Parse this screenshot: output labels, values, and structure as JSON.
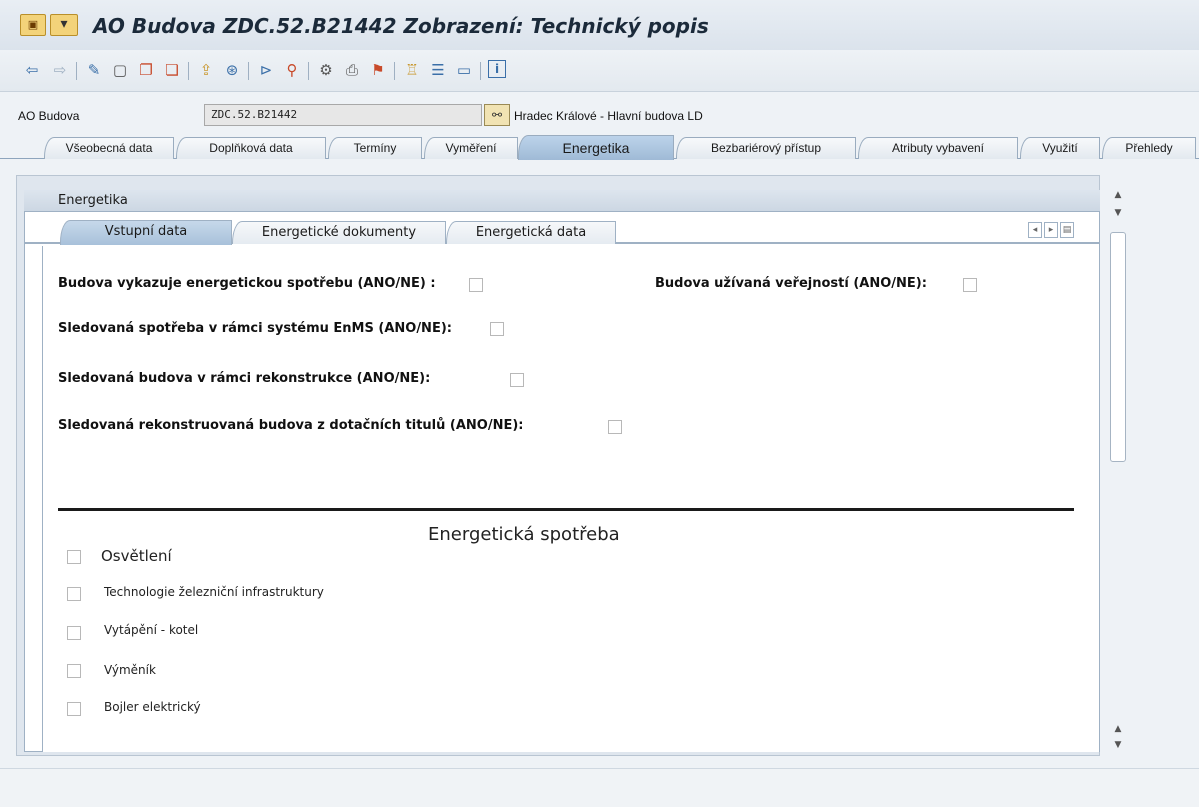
{
  "window": {
    "title": "AO Budova ZDC.52.B21442 Zobrazení: Technický popis",
    "icon": "sap-app-icon",
    "menu_icon": "window-menu-icon"
  },
  "toolbar": {
    "icons": [
      "back-icon",
      "forward-icon",
      "change-icon",
      "create-icon",
      "copy-icon",
      "paste-icon",
      "upload-icon",
      "download-icon",
      "execute-icon",
      "where-used-icon",
      "settings-icon",
      "print-icon",
      "filter-icon",
      "hierarchy-icon",
      "list-icon",
      "layout-icon",
      "info-icon"
    ]
  },
  "header": {
    "label": "AO Budova",
    "value": "ZDC.52.B21442",
    "description": "Hradec Králové - Hlavní budova LD"
  },
  "main_tabs": [
    {
      "label": "Všeobecná data",
      "active": false
    },
    {
      "label": "Doplňková data",
      "active": false
    },
    {
      "label": "Termíny",
      "active": false
    },
    {
      "label": "Vyměření",
      "active": false
    },
    {
      "label": "Energetika",
      "active": true
    },
    {
      "label": "Bezbariérový přístup",
      "active": false
    },
    {
      "label": "Atributy vybavení",
      "active": false
    },
    {
      "label": "Využití",
      "active": false
    },
    {
      "label": "Přehledy",
      "active": false
    }
  ],
  "group": {
    "title": "Energetika"
  },
  "sub_tabs": [
    {
      "label": "Vstupní data",
      "active": true
    },
    {
      "label": "Energetické dokumenty",
      "active": false
    },
    {
      "label": "Energetická data",
      "active": false
    }
  ],
  "questions": [
    {
      "label": "Budova vykazuje energetickou spotřebu (ANO/NE) :",
      "checked": false
    },
    {
      "label": "Budova užívaná veřejností (ANO/NE):",
      "checked": false
    },
    {
      "label": "Sledovaná spotřeba v rámci systému EnMS (ANO/NE):",
      "checked": false
    },
    {
      "label": "Sledovaná budova v rámci rekonstrukce (ANO/NE):",
      "checked": false
    },
    {
      "label": "Sledovaná rekonstruovaná budova z dotačních titulů (ANO/NE):",
      "checked": false
    }
  ],
  "consumption": {
    "title": "Energetická spotřeba",
    "items": [
      {
        "label": "Osvětlení",
        "checked": false
      },
      {
        "label": "Technologie železniční infrastruktury",
        "checked": false
      },
      {
        "label": "Vytápění - kotel",
        "checked": false
      },
      {
        "label": "Výměník",
        "checked": false
      },
      {
        "label": "Bojler elektrický",
        "checked": false
      }
    ]
  },
  "colors": {
    "active_tab": "#a8c1da",
    "title_text": "#1b2a3a",
    "background": "#eef2f6"
  }
}
